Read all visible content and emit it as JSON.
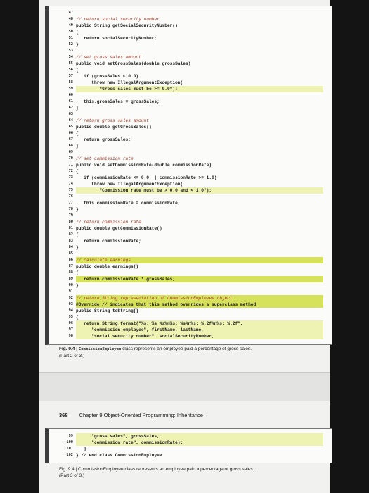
{
  "listing_part2": {
    "line_numbers": [
      "47",
      "48",
      "49",
      "50",
      "51",
      "52",
      "53",
      "54",
      "55",
      "56",
      "57",
      "58",
      "59",
      "60",
      "61",
      "62",
      "63",
      "64",
      "65",
      "66",
      "67",
      "68",
      "69",
      "70",
      "71",
      "72",
      "73",
      "74",
      "75",
      "76",
      "77",
      "78",
      "79",
      "80",
      "81",
      "82",
      "83",
      "84",
      "85",
      "86",
      "87",
      "88",
      "89",
      "90",
      "91",
      "92",
      "93",
      "94",
      "95",
      "96",
      "97",
      "98"
    ],
    "lines": [
      "",
      "// return social security number",
      "public String getSocialSecurityNumber()",
      "{",
      "   return socialSecurityNumber;",
      "}",
      "",
      "// set gross sales amount",
      "public void setGrossSales(double grossSales)",
      "{",
      "   if (grossSales < 0.0)",
      "      throw new IllegalArgumentException(",
      "         \"Gross sales must be >= 0.0\");",
      "",
      "   this.grossSales = grossSales;",
      "}",
      "",
      "// return gross sales amount",
      "public double getGrossSales()",
      "{",
      "   return grossSales;",
      "}",
      "",
      "// set commission rate",
      "public void setCommissionRate(double commissionRate)",
      "{",
      "   if (commissionRate <= 0.0 || commissionRate >= 1.0)",
      "      throw new IllegalArgumentException(",
      "         \"Commission rate must be > 0.0 and < 1.0\");",
      "",
      "   this.commissionRate = commissionRate;",
      "}",
      "",
      "// return commission rate",
      "public double getCommissionRate()",
      "{",
      "   return commissionRate;",
      "}",
      "",
      "// calculate earnings",
      "public double earnings()",
      "{",
      "   return commissionRate * grossSales;",
      "}",
      "",
      "// return String representation of CommissionEmployee object",
      "@Override // indicates that this method overrides a superclass method",
      "public String toString()",
      "{",
      "   return String.format(\"%s: %s %s%n%s: %s%n%s: %.2f%n%s: %.2f\",",
      "      \"commission employee\", firstName, lastName,",
      "      \"social security number\", socialSecurityNumber,"
    ],
    "caption_fig": "Fig. 9.4",
    "caption_class": "CommissionEmployee",
    "caption_text": "class represents an employee paid a percentage of gross sales.",
    "caption_part": "(Part 2 of 3.)"
  },
  "page_header": {
    "page_number": "368",
    "chapter": "Chapter 9",
    "title": "Object-Oriented Programming: Inheritance"
  },
  "listing_part3": {
    "line_numbers": [
      "99",
      "100",
      "101",
      "102"
    ],
    "lines": [
      "      \"gross sales\", grossSales,",
      "      \"commission rate\", commissionRate);",
      "   }",
      "} // end class CommissionEmployee"
    ],
    "caption_fig": "Fig. 9.4",
    "caption_class": "CommissionEmployee",
    "caption_text": "class represents an employee paid a percentage of gross sales.",
    "caption_part": "(Part 3 of 3.)"
  }
}
